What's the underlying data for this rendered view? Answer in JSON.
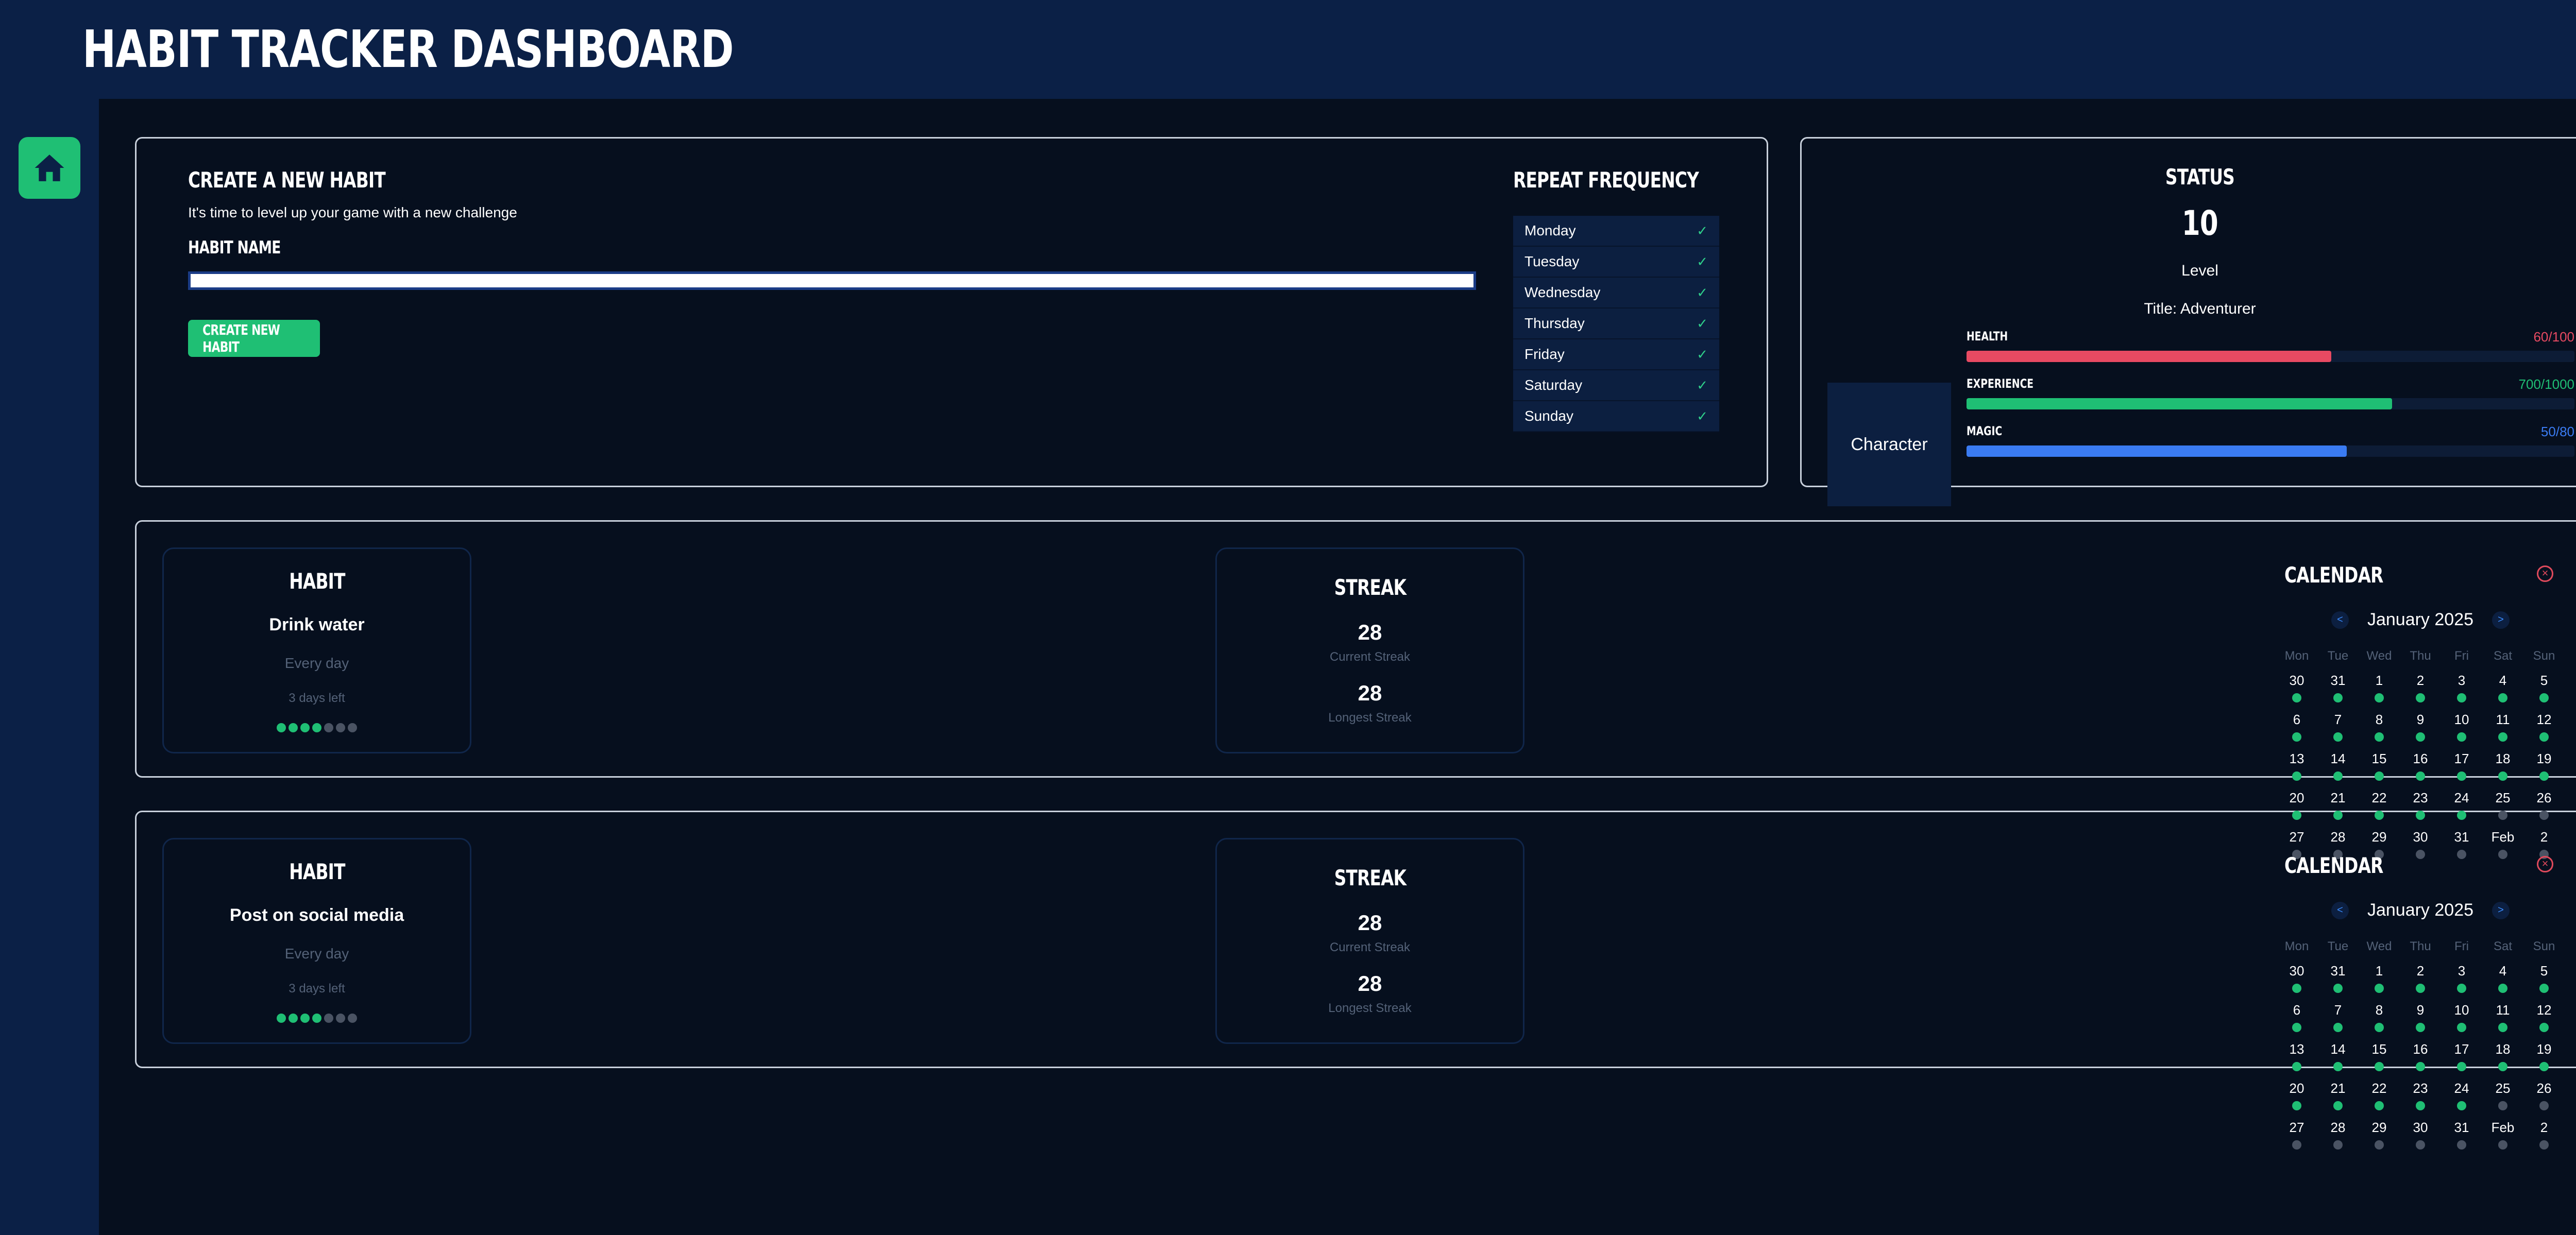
{
  "app": {
    "title": "HABIT TRACKER DASHBOARD"
  },
  "sidebar": {
    "home_icon": "home-icon"
  },
  "create_habit": {
    "title": "CREATE A NEW HABIT",
    "subtitle": "It's time to level up your game with a new challenge",
    "name_label": "HABIT NAME",
    "name_value": "",
    "button_label": "CREATE NEW HABIT",
    "frequency_title": "REPEAT FREQUENCY",
    "days": [
      {
        "label": "Monday",
        "checked": true
      },
      {
        "label": "Tuesday",
        "checked": true
      },
      {
        "label": "Wednesday",
        "checked": true
      },
      {
        "label": "Thursday",
        "checked": true
      },
      {
        "label": "Friday",
        "checked": true
      },
      {
        "label": "Saturday",
        "checked": true
      },
      {
        "label": "Sunday",
        "checked": true
      }
    ]
  },
  "status": {
    "title": "STATUS",
    "level": "10",
    "level_label": "Level",
    "title_text": "Title: Adventurer",
    "character_alt": "Character",
    "stats": [
      {
        "label": "HEALTH",
        "value": "60/100",
        "fraction": 0.6,
        "color": "#e84a62"
      },
      {
        "label": "EXPERIENCE",
        "value": "700/1000",
        "fraction": 0.7,
        "color": "#1fbf74"
      },
      {
        "label": "MAGIC",
        "value": "50/80",
        "fraction": 0.625,
        "color": "#3a7bf2"
      }
    ]
  },
  "habits": [
    {
      "card_title": "HABIT",
      "name": "Drink water",
      "frequency": "Every day",
      "days_left": "3 days left",
      "progress_dots": [
        true,
        true,
        true,
        true,
        false,
        false,
        false
      ],
      "streak_title": "STREAK",
      "current_streak": "28",
      "current_label": "Current Streak",
      "longest_streak": "28",
      "longest_label": "Longest Streak"
    },
    {
      "card_title": "HABIT",
      "name": "Post on social media",
      "frequency": "Every day",
      "days_left": "3 days left",
      "progress_dots": [
        true,
        true,
        true,
        true,
        false,
        false,
        false
      ],
      "streak_title": "STREAK",
      "current_streak": "28",
      "current_label": "Current Streak",
      "longest_streak": "28",
      "longest_label": "Longest Streak"
    }
  ],
  "calendar": {
    "title": "CALENDAR",
    "month": "January 2025",
    "prev": "<",
    "next": ">",
    "close": "×",
    "weekdays": [
      "Mon",
      "Tue",
      "Wed",
      "Thu",
      "Fri",
      "Sat",
      "Sun"
    ],
    "days": [
      {
        "d": "30",
        "done": true
      },
      {
        "d": "31",
        "done": true
      },
      {
        "d": "1",
        "done": true
      },
      {
        "d": "2",
        "done": true
      },
      {
        "d": "3",
        "done": true
      },
      {
        "d": "4",
        "done": true
      },
      {
        "d": "5",
        "done": true
      },
      {
        "d": "6",
        "done": true
      },
      {
        "d": "7",
        "done": true
      },
      {
        "d": "8",
        "done": true
      },
      {
        "d": "9",
        "done": true
      },
      {
        "d": "10",
        "done": true
      },
      {
        "d": "11",
        "done": true
      },
      {
        "d": "12",
        "done": true
      },
      {
        "d": "13",
        "done": true
      },
      {
        "d": "14",
        "done": true
      },
      {
        "d": "15",
        "done": true
      },
      {
        "d": "16",
        "done": true
      },
      {
        "d": "17",
        "done": true
      },
      {
        "d": "18",
        "done": true
      },
      {
        "d": "19",
        "done": true
      },
      {
        "d": "20",
        "done": true
      },
      {
        "d": "21",
        "done": true
      },
      {
        "d": "22",
        "done": true
      },
      {
        "d": "23",
        "done": true
      },
      {
        "d": "24",
        "done": true
      },
      {
        "d": "25",
        "done": false
      },
      {
        "d": "26",
        "done": false
      },
      {
        "d": "27",
        "done": false
      },
      {
        "d": "28",
        "done": false
      },
      {
        "d": "29",
        "done": false
      },
      {
        "d": "30",
        "done": false
      },
      {
        "d": "31",
        "done": false
      },
      {
        "d": "Feb",
        "done": false
      },
      {
        "d": "2",
        "done": false
      }
    ]
  },
  "colors": {
    "accent": "#1fbf74",
    "dot_off": "#4a5363",
    "panel_border": "#c8d0dc"
  }
}
